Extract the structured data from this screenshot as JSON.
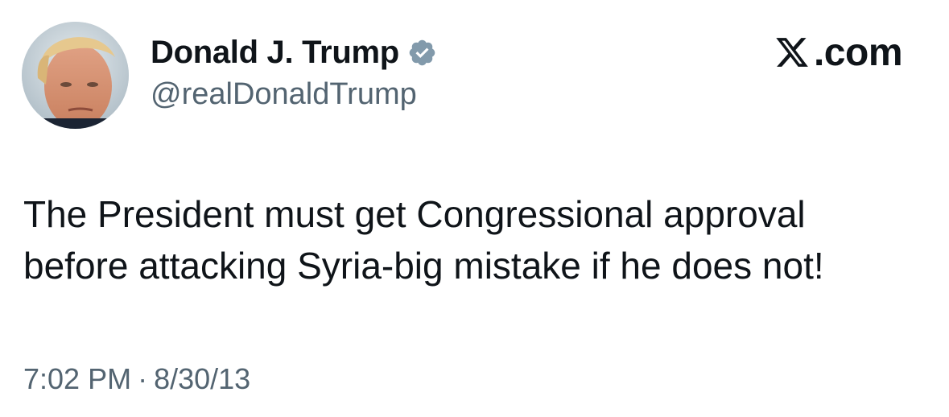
{
  "author": {
    "display_name": "Donald J. Trump",
    "handle": "@realDonaldTrump",
    "verified": true,
    "verified_color": "#829aab"
  },
  "brand": {
    "text": ".com",
    "icon": "x-logo-icon"
  },
  "tweet": {
    "lines": [
      "The President must get Congressional approval",
      "before attacking Syria-big mistake if he does not!"
    ]
  },
  "meta": {
    "time": "7:02 PM",
    "separator": "·",
    "date": "8/30/13"
  },
  "colors": {
    "text": "#0f1419",
    "secondary": "#536471",
    "background": "#ffffff"
  }
}
